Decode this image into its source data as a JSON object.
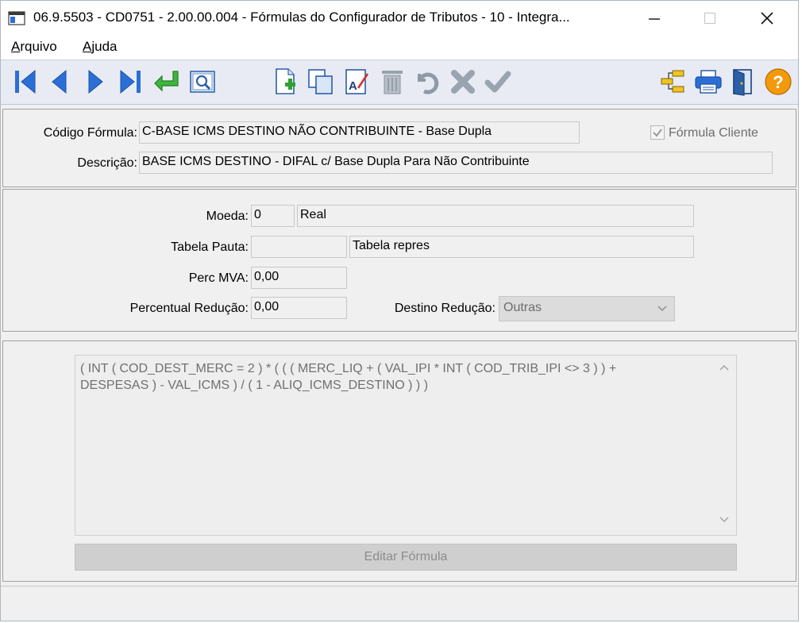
{
  "window": {
    "title": "06.9.5503 - CD0751 - 2.00.00.004 - Fórmulas do Configurador de Tributos - 10 - Integra...",
    "icon": "app-window-icon"
  },
  "menu": {
    "items": [
      {
        "underline": "A",
        "rest": "rquivo"
      },
      {
        "underline": "A",
        "rest": "juda"
      }
    ]
  },
  "toolbar": {
    "icons": [
      "first-record-icon",
      "previous-record-icon",
      "next-record-icon",
      "last-record-icon",
      "goto-icon",
      "zoom-icon",
      "new-icon",
      "copy-icon",
      "modify-icon",
      "delete-icon",
      "undo-icon",
      "cancel-icon",
      "confirm-icon",
      "tree-icon",
      "print-icon",
      "exit-icon",
      "help-icon"
    ],
    "help_glyph": "?"
  },
  "header": {
    "codigo_label": "Código Fórmula:",
    "codigo_value": "C-BASE ICMS DESTINO NÃO CONTRIBUINTE - Base Dupla",
    "descricao_label": "Descrição:",
    "descricao_value": "BASE ICMS DESTINO - DIFAL c/ Base Dupla Para Não Contribuinte",
    "formula_cliente_label": "Fórmula Cliente",
    "formula_cliente_checked": true
  },
  "params": {
    "moeda_label": "Moeda:",
    "moeda_code": "0",
    "moeda_name": "Real",
    "tabela_label": "Tabela Pauta:",
    "tabela_code": "",
    "tabela_name": "Tabela repres",
    "mva_label": "Perc MVA:",
    "mva_value": "0,00",
    "reducao_label": "Percentual Redução:",
    "reducao_value": "0,00",
    "destino_label": "Destino Redução:",
    "destino_value": "Outras"
  },
  "formula": {
    "text": "( INT ( COD_DEST_MERC = 2 ) * ( ( ( MERC_LIQ + ( VAL_IPI * INT ( COD_TRIB_IPI <> 3 ) ) +\nDESPESAS ) - VAL_ICMS ) / ( 1 - ALIQ_ICMS_DESTINO ) ) )",
    "edit_button": "Editar Fórmula"
  },
  "colors": {
    "nav_blue": "#2b6fd6",
    "green": "#2fa12f",
    "gray_icon": "#8f9aa8",
    "help_orange": "#f39a0c"
  }
}
